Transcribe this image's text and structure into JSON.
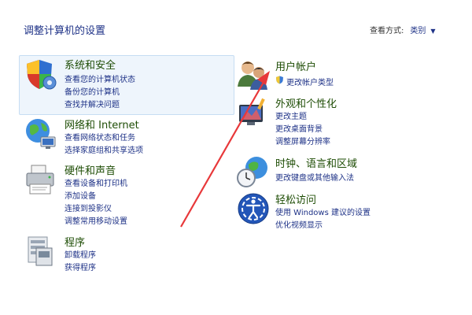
{
  "header": {
    "title": "调整计算机的设置",
    "view_by_label": "查看方式:",
    "view_by_value": "类别"
  },
  "categories": {
    "system": {
      "title": "系统和安全",
      "links": [
        "查看您的计算机状态",
        "备份您的计算机",
        "查找并解决问题"
      ]
    },
    "network": {
      "title": "网络和 Internet",
      "links": [
        "查看网络状态和任务",
        "选择家庭组和共享选项"
      ]
    },
    "hardware": {
      "title": "硬件和声音",
      "links": [
        "查看设备和打印机",
        "添加设备",
        "连接到投影仪",
        "调整常用移动设置"
      ]
    },
    "programs": {
      "title": "程序",
      "links": [
        "卸载程序",
        "获得程序"
      ]
    },
    "users": {
      "title": "用户帐户",
      "links": [
        "更改帐户类型"
      ]
    },
    "appearance": {
      "title": "外观和个性化",
      "links": [
        "更改主题",
        "更改桌面背景",
        "调整屏幕分辨率"
      ]
    },
    "clock": {
      "title": "时钟、语言和区域",
      "links": [
        "更改键盘或其他输入法"
      ]
    },
    "ease": {
      "title": "轻松访问",
      "links": [
        "使用 Windows 建议的设置",
        "优化视频显示"
      ]
    }
  },
  "colors": {
    "link": "#1e3287",
    "category_title": "#1e4d05",
    "arrow": "#e8383a",
    "highlight_bg": "#eef5fc"
  }
}
